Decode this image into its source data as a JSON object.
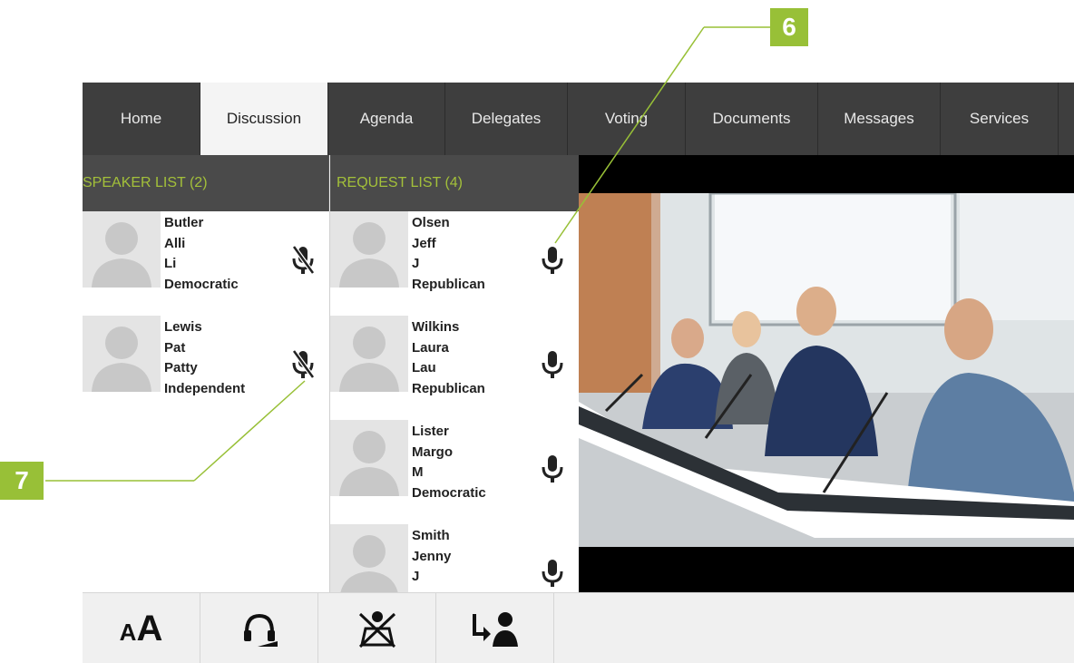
{
  "nav": {
    "tabs": [
      {
        "label": "Home",
        "active": false
      },
      {
        "label": "Discussion",
        "active": true
      },
      {
        "label": "Agenda",
        "active": false
      },
      {
        "label": "Delegates",
        "active": false
      },
      {
        "label": "Voting",
        "active": false
      },
      {
        "label": "Documents",
        "active": false
      },
      {
        "label": "Messages",
        "active": false
      },
      {
        "label": "Services",
        "active": false
      }
    ]
  },
  "speaker_list": {
    "title": "SPEAKER LIST (2)",
    "items": [
      {
        "last": "Butler",
        "first": "Alli",
        "short": "Li",
        "party": "Democratic",
        "mic_icon": "mic-muted-icon"
      },
      {
        "last": "Lewis",
        "first": "Pat",
        "short": "Patty",
        "party": "Independent",
        "mic_icon": "mic-muted-icon"
      }
    ]
  },
  "request_list": {
    "title": "REQUEST LIST (4)",
    "items": [
      {
        "last": "Olsen",
        "first": "Jeff",
        "short": "J",
        "party": "Republican",
        "mic_icon": "mic-icon"
      },
      {
        "last": "Wilkins",
        "first": "Laura",
        "short": "Lau",
        "party": "Republican",
        "mic_icon": "mic-icon"
      },
      {
        "last": "Lister",
        "first": "Margo",
        "short": "M",
        "party": "Democratic",
        "mic_icon": "mic-icon"
      },
      {
        "last": "Smith",
        "first": "Jenny",
        "short": "J",
        "party": "",
        "mic_icon": "mic-icon"
      }
    ]
  },
  "bottom_toolbar": {
    "tools": [
      "font-size-icon",
      "headset-icon",
      "mute-all-icon",
      "transfer-speaker-icon"
    ],
    "font_small": "A",
    "font_large": "A"
  },
  "callouts": {
    "c6": "6",
    "c7": "7"
  },
  "colors": {
    "accent": "#98c037",
    "nav_bg": "#3e3e3e",
    "header_text": "#a3c03a"
  }
}
